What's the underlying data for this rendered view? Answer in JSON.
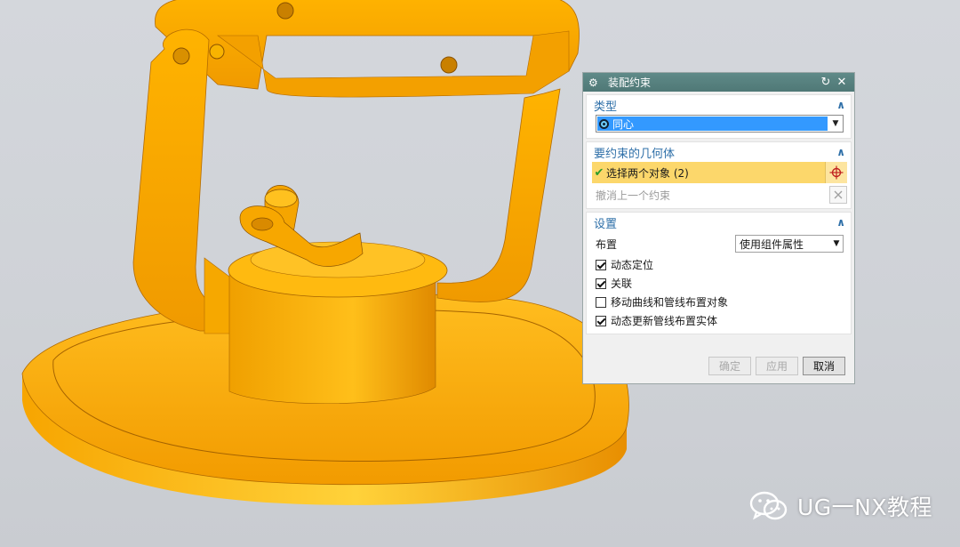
{
  "dialog": {
    "title": "装配约束",
    "title_icons": [
      "gear-icon",
      "reset-icon",
      "close-icon"
    ],
    "reset_glyph": "↻",
    "close_glyph": "✕",
    "sections": {
      "type": {
        "label": "类型",
        "selected": "同心"
      },
      "geometry": {
        "label": "要约束的几何体",
        "select_objects": "选择两个对象 (2)",
        "undo_last": "撤消上一个约束"
      },
      "settings": {
        "label": "设置",
        "layout_label": "布置",
        "layout_value": "使用组件属性",
        "checkboxes": [
          {
            "label": "动态定位",
            "checked": true
          },
          {
            "label": "关联",
            "checked": true
          },
          {
            "label": "移动曲线和管线布置对象",
            "checked": false
          },
          {
            "label": "动态更新管线布置实体",
            "checked": true
          }
        ]
      }
    },
    "buttons": {
      "ok": "确定",
      "apply": "应用",
      "cancel": "取消"
    }
  },
  "watermark": {
    "text": "UG一NX教程"
  },
  "colors": {
    "title_bar": "#5a8584",
    "section_header": "#2e6fa8",
    "selected_highlight": "#3399ff",
    "active_row": "#fcd76b",
    "model": "#f5a300"
  }
}
